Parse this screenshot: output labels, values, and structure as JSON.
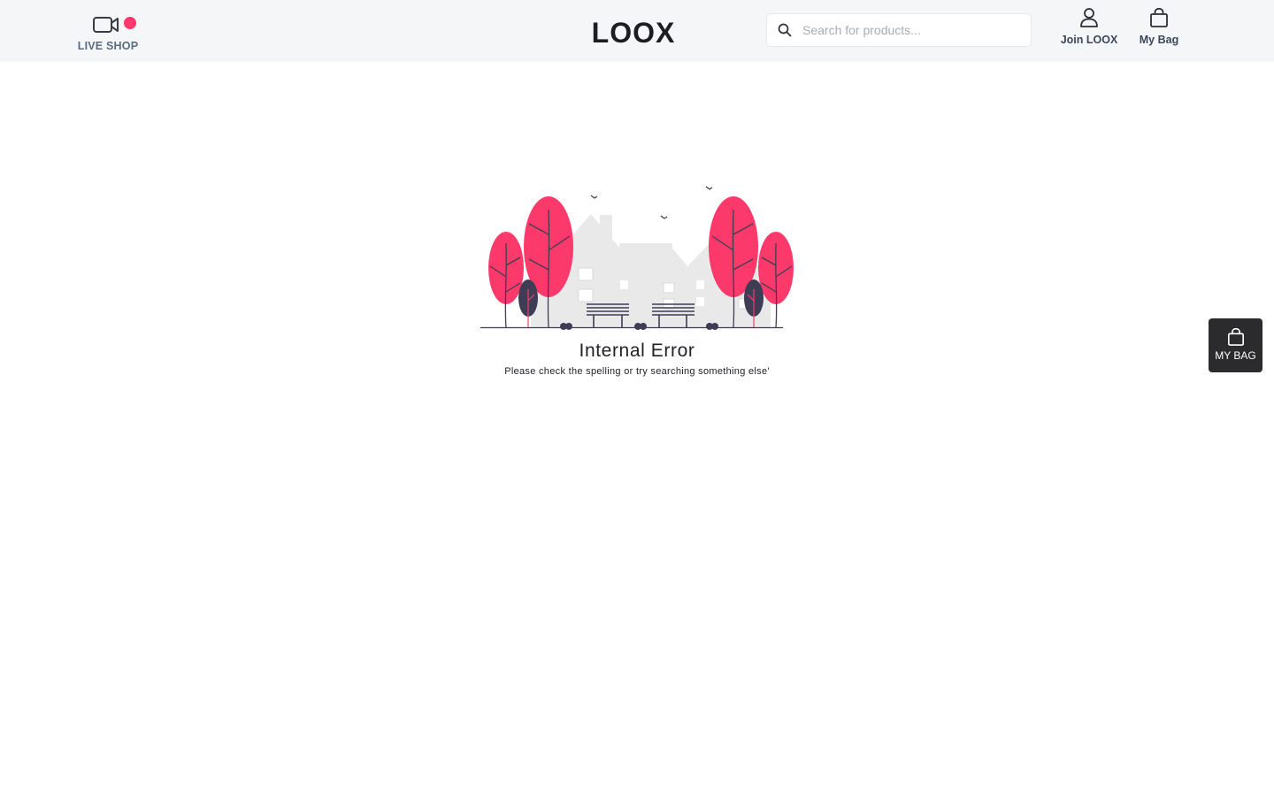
{
  "header": {
    "live_shop_label": "LIVE SHOP",
    "logo_text": "LOOX",
    "search_placeholder": "Search for products...",
    "join_label": "Join LOOX",
    "bag_label": "My Bag"
  },
  "main": {
    "error_title": "Internal Error",
    "error_message": "Please check the spelling or try searching something else'"
  },
  "floating_bag": {
    "label": "MY BAG"
  },
  "icons": {
    "live_shop": "video-camera-icon",
    "live_indicator": "live-dot-icon",
    "search": "search-icon",
    "join": "user-icon",
    "bag": "shopping-bag-icon"
  },
  "colors": {
    "accent": "#fb3a6b",
    "header_bg": "#f5f6f8",
    "dark": "#2b2b2e",
    "tree_dark": "#3f3d56"
  }
}
